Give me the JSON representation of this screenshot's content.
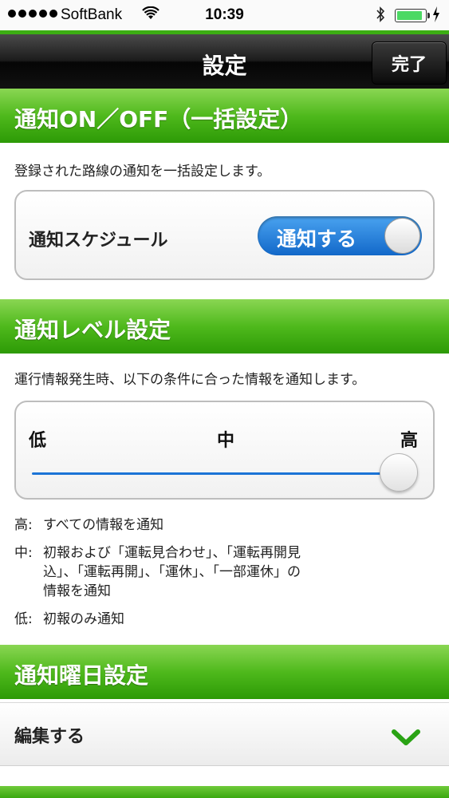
{
  "status_bar": {
    "carrier": "SoftBank",
    "time": "10:39",
    "battery_level": 0.85
  },
  "nav": {
    "title": "設定",
    "done_label": "完了"
  },
  "section_bulk": {
    "header": "通知ON／OFF（一括設定）",
    "description": "登録された路線の通知を一括設定します。",
    "schedule_label": "通知スケジュール",
    "switch_label": "通知する"
  },
  "section_level": {
    "header": "通知レベル設定",
    "description": "運行情報発生時、以下の条件に合った情報を通知します。",
    "slider_labels": {
      "low": "低",
      "mid": "中",
      "high": "高"
    },
    "slider_value": "高",
    "notes": [
      {
        "key": "高:",
        "text": "すべての情報を通知"
      },
      {
        "key": "中:",
        "text_line1": "初報および「運転見合わせ」、「運転再開見",
        "text_line2": "込」、「運転再開」、「運休」、「一部運休」の",
        "text_line3": "情報を通知"
      },
      {
        "key": "低:",
        "text": "初報のみ通知"
      }
    ]
  },
  "section_days": {
    "header": "通知曜日設定",
    "edit_label": "編集する"
  },
  "colors": {
    "accent_green": "#4fb91c",
    "switch_blue": "#1268c9",
    "nav_black": "#111111"
  }
}
